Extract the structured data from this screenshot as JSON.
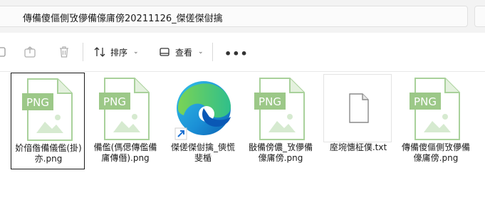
{
  "address": {
    "path": "傳備傻傴側攷儚備儫庯傍20211126_傑傞傑傠擒"
  },
  "toolbar": {
    "sort_label": "排序",
    "view_label": "查看",
    "more_label": "•••"
  },
  "files": [
    {
      "name": "妎偣偺備儀儖(掛)亦.png",
      "type": "png",
      "selected": true
    },
    {
      "name": "備儖(傌偲傳儖備庯傳僭).png",
      "type": "png",
      "selected": false
    },
    {
      "name": "傑傞傑傠擒_傸慌斐楯",
      "type": "edge",
      "selected": false
    },
    {
      "name": "敯備傍儂_攷儚備儫庯傍.png",
      "type": "png",
      "selected": false
    },
    {
      "name": "庢埦憓柾僕.txt",
      "type": "txt",
      "selected": false
    },
    {
      "name": "傳備傻傴側攷儚備儫庯傍.png",
      "type": "png",
      "selected": false
    }
  ],
  "png_badge": "PNG",
  "colors": {
    "png_green": "#9fc98e",
    "png_badge_bg": "#8fbf7c",
    "accent": "#0a64d8"
  }
}
